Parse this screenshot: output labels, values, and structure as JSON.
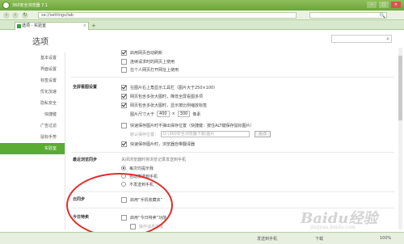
{
  "window": {
    "title": "360安全浏览器 7.1",
    "minimize": "–",
    "maximize": "□",
    "close": "✕"
  },
  "toolbar": {
    "back": "‹",
    "forward": "›",
    "refresh": "↻",
    "address": "se://settings/lab",
    "search_icon": "🔍"
  },
  "tabs": [
    {
      "label": "选项 - 实验室",
      "close": "×"
    }
  ],
  "tab_add": "+",
  "page": {
    "title": "选项"
  },
  "sidebar": {
    "items": [
      {
        "label": "基本设置",
        "active": false
      },
      {
        "label": "界面设置",
        "active": false
      },
      {
        "label": "标签设置",
        "active": false
      },
      {
        "label": "优化加速",
        "active": false
      },
      {
        "label": "隐私安全",
        "active": false
      },
      {
        "label": "快捷键",
        "active": false
      },
      {
        "label": "广告过滤",
        "active": false
      },
      {
        "label": "鼠标手势",
        "active": false
      },
      {
        "label": "实验室",
        "active": true
      }
    ]
  },
  "sections": {
    "top_rows": [
      {
        "label": "启用网页自动刷新",
        "checked": true
      },
      {
        "label": "连续请求时的网页上使用",
        "checked": false
      },
      {
        "label": "在个人网页打开网址上使用",
        "checked": false
      }
    ],
    "image_viewer": {
      "label": "全屏看图设置",
      "rows": [
        {
          "label": "在图片右上角显示工具栏（图片大于250×100）",
          "checked": true
        },
        {
          "label": "网页包含多张大图时，降低全屏看图多项",
          "checked": true
        },
        {
          "label": "网页包含多张大图时，显示按比例缩放标签",
          "checked": true
        }
      ],
      "size_label": "图片尺寸大于",
      "width": "400",
      "x_sep": "×",
      "height": "300",
      "unit": "像素",
      "save_row": "快速保存图片时不弹出保存位置（快捷键：按住ALT键保存鼠标图片）",
      "path_label": "默认保存位置：",
      "path_value": "D:\\360安全浏览器下载\\图片",
      "browse": "更改",
      "last_row": "快速保存图片时，浏览器自带翻译器"
    },
    "sync": {
      "label": "最近浏览同步",
      "desc": "关闭浏览器时将浏览记录发送到手机",
      "options": [
        {
          "label": "每次均提示我",
          "checked": true
        },
        {
          "label": "自动发送到手机",
          "checked": false
        },
        {
          "label": "不发送到手机",
          "checked": false
        }
      ]
    },
    "cloud": {
      "label": "云同步",
      "row": "启用“手机收藏夹”",
      "checked": false
    },
    "today": {
      "label": "今日特卖",
      "row": "启用“今日特卖”功能",
      "checked": false,
      "sub": "操作消息提醒",
      "sub_checked": false
    }
  },
  "status": {
    "send_phone": "发送到手机",
    "download": "下载",
    "zoom": "100%"
  },
  "watermark": {
    "main": "Baidu经验",
    "sub": "jingyan.baidu.com"
  }
}
